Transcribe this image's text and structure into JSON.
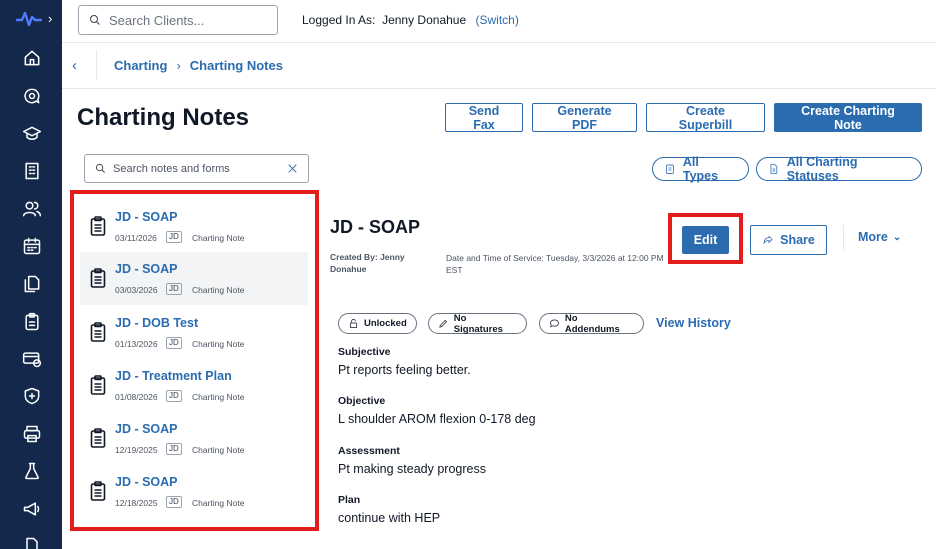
{
  "topbar": {
    "search_placeholder": "Search Clients...",
    "logged_in_label": "Logged In As:",
    "user_name": "Jenny Donahue",
    "switch_label": "(Switch)"
  },
  "breadcrumb": {
    "items": [
      "Charting",
      "Charting Notes"
    ]
  },
  "page": {
    "title": "Charting Notes",
    "actions": {
      "send_fax": "Send Fax",
      "generate_pdf": "Generate PDF",
      "create_superbill": "Create Superbill",
      "create_note": "Create Charting Note"
    }
  },
  "notes_search": {
    "placeholder": "Search notes and forms"
  },
  "filters": {
    "types": "All Types",
    "statuses": "All Charting Statuses"
  },
  "notes": [
    {
      "title": "JD - SOAP",
      "date": "03/11/2026",
      "tag": "JD",
      "type": "Charting Note",
      "selected": false
    },
    {
      "title": "JD - SOAP",
      "date": "03/03/2026",
      "tag": "JD",
      "type": "Charting Note",
      "selected": true
    },
    {
      "title": "JD - DOB Test",
      "date": "01/13/2026",
      "tag": "JD",
      "type": "Charting Note",
      "selected": false
    },
    {
      "title": "JD - Treatment Plan",
      "date": "01/08/2026",
      "tag": "JD",
      "type": "Charting Note",
      "selected": false
    },
    {
      "title": "JD - SOAP",
      "date": "12/19/2025",
      "tag": "JD",
      "type": "Charting Note",
      "selected": false
    },
    {
      "title": "JD - SOAP",
      "date": "12/18/2025",
      "tag": "JD",
      "type": "Charting Note",
      "selected": false
    }
  ],
  "detail": {
    "title": "JD - SOAP",
    "created_by_label": "Created By: Jenny",
    "created_by_value": "Donahue",
    "date_of_service": "Date and Time of Service: Tuesday, 3/3/2026 at 12:00 PM EST",
    "edit_label": "Edit",
    "share_label": "Share",
    "more_label": "More",
    "statuses": {
      "lock": "Unlocked",
      "signatures": "No Signatures",
      "addendums": "No Addendums"
    },
    "view_history": "View History",
    "sections": [
      {
        "label": "Subjective",
        "text": "Pt reports feeling better."
      },
      {
        "label": "Objective",
        "text": "L shoulder AROM flexion 0-178 deg"
      },
      {
        "label": "Assessment",
        "text": "Pt making steady progress"
      },
      {
        "label": "Plan",
        "text": "continue with HEP"
      }
    ]
  },
  "colors": {
    "sidebar": "#13284a",
    "accent": "#2b6cb0",
    "highlight": "#e11d1d",
    "logo": "#4f7cff"
  }
}
